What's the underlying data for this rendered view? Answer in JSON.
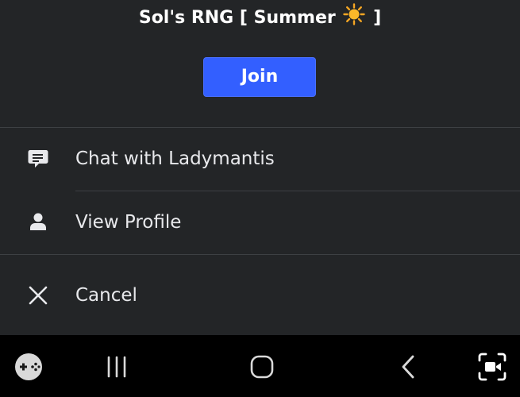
{
  "header": {
    "title_prefix": "Sol's RNG [ Summer",
    "title_suffix": "]",
    "sun_emoji": "sun-icon"
  },
  "join_button": {
    "label": "Join",
    "color": "#335fff"
  },
  "menu": {
    "items": [
      {
        "label": "Chat with Ladymantis",
        "icon": "chat-icon"
      },
      {
        "label": "View Profile",
        "icon": "person-icon"
      },
      {
        "label": "Cancel",
        "icon": "close-icon"
      }
    ]
  },
  "navbar": {
    "buttons": [
      "game-controller-icon",
      "recent-apps-icon",
      "home-icon",
      "back-icon",
      "screen-recorder-icon"
    ]
  }
}
